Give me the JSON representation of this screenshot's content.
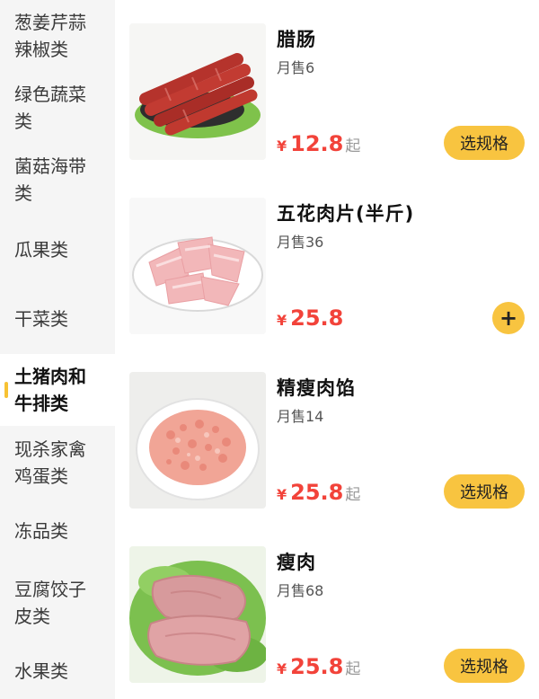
{
  "sidebar": {
    "categories": [
      {
        "label": "葱姜芹蒜\n辣椒类"
      },
      {
        "label": "绿色蔬菜\n类"
      },
      {
        "label": "菌菇海带\n类"
      },
      {
        "label": "瓜果类"
      },
      {
        "label": "干菜类"
      },
      {
        "label": "土猪肉和\n牛排类",
        "active": true
      },
      {
        "label": "现杀家禽\n鸡蛋类"
      },
      {
        "label": "冻品类"
      },
      {
        "label": "豆腐饺子\n皮类"
      },
      {
        "label": "水果类"
      }
    ]
  },
  "products": [
    {
      "name": "腊肠",
      "sold": "月售6",
      "currency": "¥",
      "price": "12.8",
      "suffix": "起",
      "action": "选规格",
      "image_icon": "sausage-image"
    },
    {
      "name": "五花肉片(半斤)",
      "sold": "月售36",
      "currency": "¥",
      "price": "25.8",
      "suffix": "",
      "action": "+",
      "image_icon": "pork-belly-image"
    },
    {
      "name": "精瘦肉馅",
      "sold": "月售14",
      "currency": "¥",
      "price": "25.8",
      "suffix": "起",
      "action": "选规格",
      "image_icon": "minced-pork-image"
    },
    {
      "name": "瘦肉",
      "sold": "月售68",
      "currency": "¥",
      "price": "25.8",
      "suffix": "起",
      "action": "选规格",
      "image_icon": "lean-pork-image"
    }
  ],
  "colors": {
    "accent": "#f8c440",
    "price": "#f2433a",
    "sidebar_bg": "#f5f5f5"
  }
}
